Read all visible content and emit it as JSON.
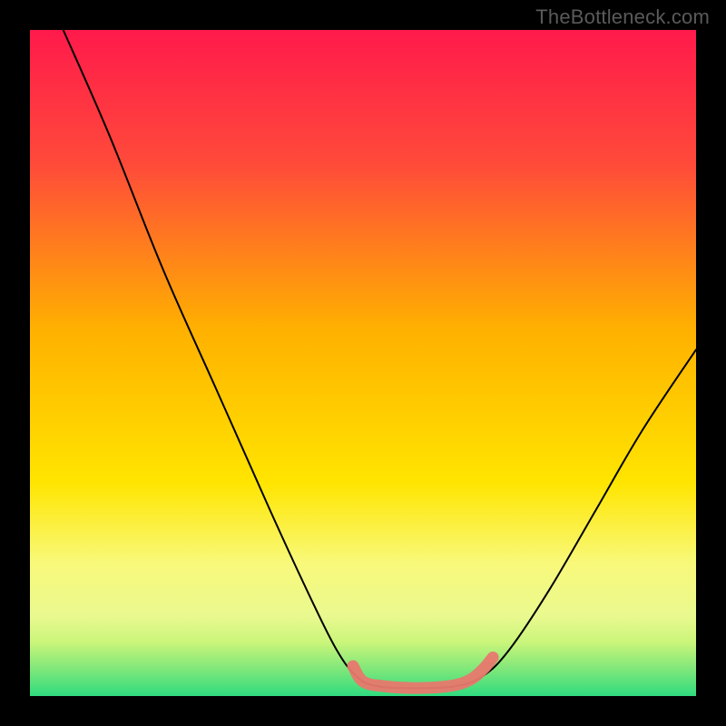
{
  "watermark": "TheBottleneck.com",
  "chart_data": {
    "type": "line",
    "title": "",
    "xlabel": "",
    "ylabel": "",
    "xlim": [
      0,
      100
    ],
    "ylim": [
      0,
      100
    ],
    "gradient_stops": [
      {
        "offset": 0,
        "color": "#ff1a4b"
      },
      {
        "offset": 20,
        "color": "#ff4a3a"
      },
      {
        "offset": 45,
        "color": "#ffb100"
      },
      {
        "offset": 68,
        "color": "#ffe500"
      },
      {
        "offset": 80,
        "color": "#f8f97a"
      },
      {
        "offset": 88,
        "color": "#eaf98f"
      },
      {
        "offset": 92,
        "color": "#c9f57a"
      },
      {
        "offset": 96,
        "color": "#7ee77a"
      },
      {
        "offset": 100,
        "color": "#2fdc7f"
      }
    ],
    "series": [
      {
        "name": "bottleneck-curve",
        "color": "#000000",
        "width": 2,
        "points": [
          {
            "x": 5,
            "y": 100
          },
          {
            "x": 12,
            "y": 84
          },
          {
            "x": 20,
            "y": 64
          },
          {
            "x": 28,
            "y": 46
          },
          {
            "x": 36,
            "y": 28
          },
          {
            "x": 42,
            "y": 15
          },
          {
            "x": 46,
            "y": 7
          },
          {
            "x": 49,
            "y": 3
          },
          {
            "x": 52,
            "y": 1.5
          },
          {
            "x": 58,
            "y": 1.2
          },
          {
            "x": 64,
            "y": 1.5
          },
          {
            "x": 68,
            "y": 3
          },
          {
            "x": 72,
            "y": 7
          },
          {
            "x": 78,
            "y": 16
          },
          {
            "x": 85,
            "y": 28
          },
          {
            "x": 92,
            "y": 40
          },
          {
            "x": 100,
            "y": 52
          }
        ]
      },
      {
        "name": "highlight-band",
        "color": "#e8786e",
        "width": 13,
        "opacity": 0.95,
        "points": [
          {
            "x": 48.5,
            "y": 4.5
          },
          {
            "x": 50,
            "y": 2.2
          },
          {
            "x": 53,
            "y": 1.5
          },
          {
            "x": 58,
            "y": 1.2
          },
          {
            "x": 63,
            "y": 1.5
          },
          {
            "x": 66,
            "y": 2.4
          },
          {
            "x": 68,
            "y": 4.0
          },
          {
            "x": 69.5,
            "y": 5.8
          }
        ]
      }
    ]
  }
}
